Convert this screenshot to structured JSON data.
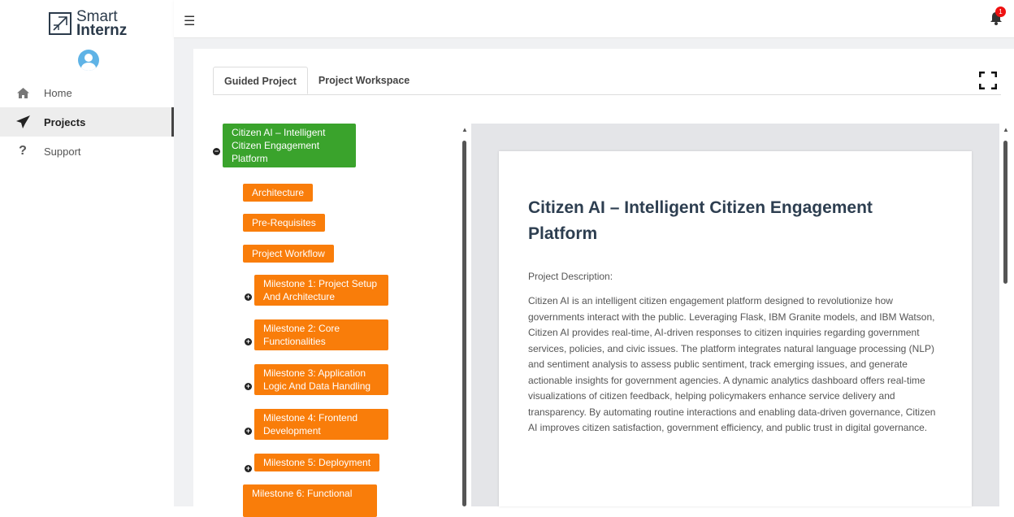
{
  "brand": {
    "line1": "Smart",
    "line2": "Internz"
  },
  "sidebar": {
    "items": [
      {
        "label": "Home",
        "icon": "home-icon"
      },
      {
        "label": "Projects",
        "icon": "paper-plane-icon",
        "active": true
      },
      {
        "label": "Support",
        "icon": "question-icon"
      }
    ]
  },
  "header": {
    "notification_count": "1"
  },
  "tabs": [
    {
      "label": "Guided Project",
      "active": true
    },
    {
      "label": "Project Workspace"
    }
  ],
  "tree": {
    "root": "Citizen AI – Intelligent Citizen Engagement Platform",
    "children": [
      "Architecture",
      "Pre-Requisites",
      "Project Workflow",
      "Milestone 1: Project Setup And Architecture",
      "Milestone 2: Core Functionalities",
      "Milestone 3: Application Logic And Data Handling",
      "Milestone 4: Frontend Development",
      "Milestone 5: Deployment",
      "Milestone 6: Functional"
    ]
  },
  "doc": {
    "title": "Citizen AI – Intelligent Citizen Engagement Platform",
    "subtitle": "Project Description:",
    "body": "Citizen AI is an intelligent citizen engagement platform designed to revolutionize how governments interact with the public. Leveraging Flask, IBM Granite models, and IBM Watson, Citizen AI provides real-time, AI-driven responses to citizen inquiries regarding government services, policies, and civic issues. The platform integrates natural language processing (NLP) and sentiment analysis to assess public sentiment, track emerging issues, and generate actionable insights for government agencies. A dynamic analytics dashboard offers real-time visualizations of citizen feedback, helping policymakers enhance service delivery and transparency. By automating routine interactions and enabling data-driven governance, Citizen AI improves citizen satisfaction, government efficiency, and public trust in digital governance."
  },
  "colors": {
    "root_node": "#3aa32c",
    "child_node": "#f97d0a",
    "accent_badge": "#e11111"
  }
}
